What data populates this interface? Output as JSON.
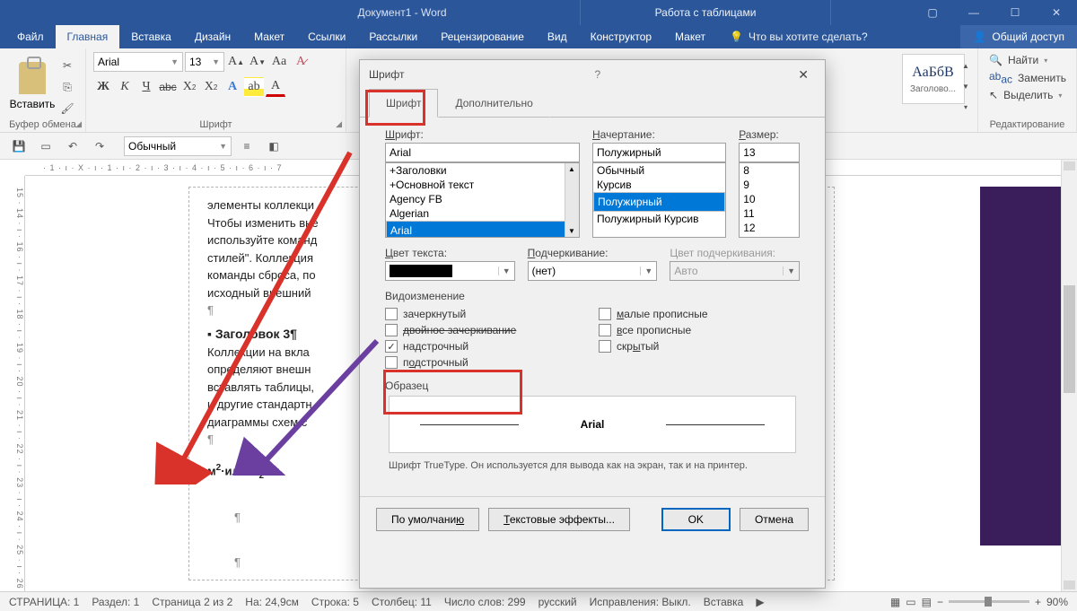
{
  "titlebar": {
    "title": "Документ1 - Word",
    "tools": "Работа с таблицами"
  },
  "tabs": {
    "file": "Файл",
    "home": "Главная",
    "insert": "Вставка",
    "design": "Дизайн",
    "layout": "Макет",
    "refs": "Ссылки",
    "mail": "Рассылки",
    "review": "Рецензирование",
    "view": "Вид",
    "constructor": "Конструктор",
    "layout2": "Макет",
    "tell": "Что вы хотите сделать?",
    "share": "Общий доступ"
  },
  "ribbon": {
    "clipboard": {
      "paste": "Вставить",
      "label": "Буфер обмена"
    },
    "font": {
      "name": "Arial",
      "size": "13",
      "label": "Шрифт",
      "bold": "Ж",
      "italic": "К",
      "underline": "Ч"
    },
    "styles": {
      "sample": "АаБбВ",
      "name": "Заголово..."
    },
    "editing": {
      "find": "Найти",
      "replace": "Заменить",
      "select": "Выделить",
      "label": "Редактирование"
    }
  },
  "qat": {
    "style": "Обычный"
  },
  "ruler": {
    "h": "· 1 · ı · X · ı · 1 · ı · 2 · ı · 3 · ı · 4 · ı · 5 · ı · 6 · ı · 7",
    "v": "15 · 14 · ı · 16 · ı · 17 · ı · 18 · ı · 19 · ı · 20 · ı · 21 · ı · 22 · ı · 23 · ı · 24 · ı · 25 · ı · 26"
  },
  "doc": {
    "l1": "элементы коллекци",
    "l2": "Чтобы изменить вне",
    "l3": "используйте команд",
    "l4": "стилей\". Коллекция",
    "l5": "команды сброса, по",
    "l6": "исходный внешний",
    "h3": "▪ Заголовок 3¶",
    "l7": "Коллекции на вкла",
    "l8": "определяют внешн",
    "l9": "вставлять таблицы,",
    "l10": "и другие стандартн",
    "l11": "диаграммы схем с",
    "formula": "м²·или·H₂O¤",
    "pil": "¶"
  },
  "dialog": {
    "title": "Шрифт",
    "tab_font": "Шрифт",
    "tab_adv": "Дополнительно",
    "lbl_font": "Шрифт:",
    "lbl_style": "Начертание:",
    "lbl_size": "Размер:",
    "font_val": "Arial",
    "font_list": [
      "+Заголовки",
      "+Основной текст",
      "Agency FB",
      "Algerian",
      "Arial"
    ],
    "style_val": "Полужирный",
    "style_list": [
      "Обычный",
      "Курсив",
      "Полужирный",
      "Полужирный Курсив"
    ],
    "size_val": "13",
    "size_list": [
      "8",
      "9",
      "10",
      "11",
      "12"
    ],
    "lbl_color": "Цвет текста:",
    "lbl_under": "Подчеркивание:",
    "lbl_ucolor": "Цвет подчеркивания:",
    "under_val": "(нет)",
    "ucolor_val": "Авто",
    "effects_lbl": "Видоизменение",
    "eff": {
      "strike": "зачеркнутый",
      "dstrike": "двойное зачеркивание",
      "super": "надстрочный",
      "sub": "подстрочный",
      "smallcaps": "малые прописные",
      "allcaps": "все прописные",
      "hidden": "скрытый"
    },
    "sample_lbl": "Образец",
    "sample_text": "Arial",
    "help": "Шрифт TrueType. Он используется для вывода как на экран, так и на принтер.",
    "btn_default": "По умолчанию",
    "btn_effects": "Текстовые эффекты...",
    "btn_ok": "OK",
    "btn_cancel": "Отмена"
  },
  "status": {
    "page": "СТРАНИЦА: 1",
    "section": "Раздел: 1",
    "pageof": "Страница 2 из 2",
    "at": "На: 24,9см",
    "line": "Строка: 5",
    "col": "Столбец: 11",
    "words": "Число слов: 299",
    "lang": "русский",
    "track": "Исправления: Выкл.",
    "insert": "Вставка",
    "zoom": "90%"
  }
}
